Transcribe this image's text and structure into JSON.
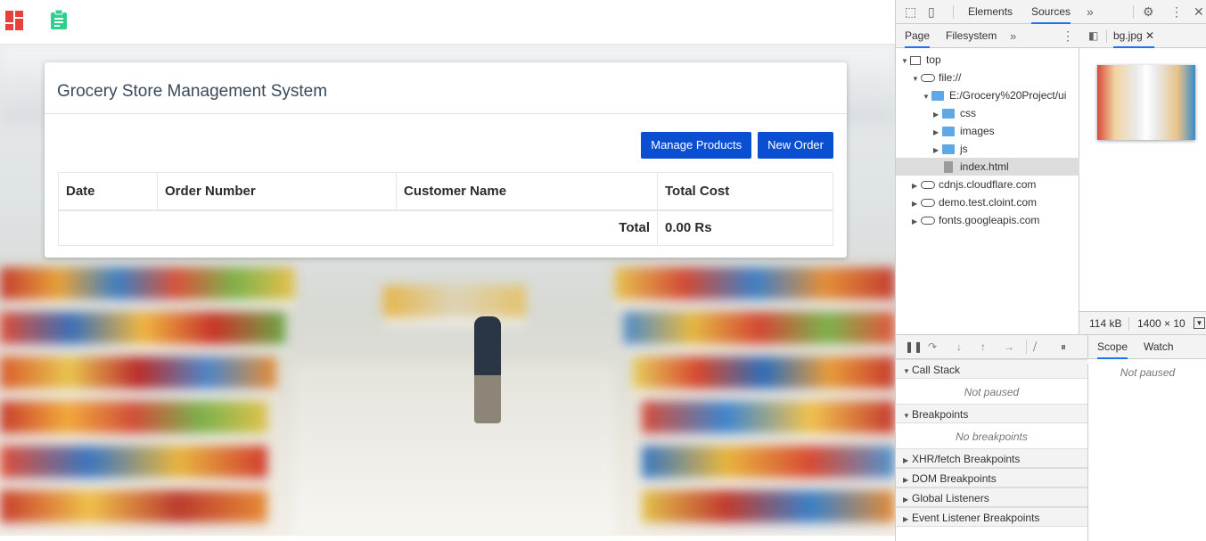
{
  "page": {
    "title": "Grocery Store Management System",
    "buttons": {
      "manage_products": "Manage Products",
      "new_order": "New Order"
    },
    "table": {
      "headers": [
        "Date",
        "Order Number",
        "Customer Name",
        "Total Cost"
      ],
      "total_label": "Total",
      "total_value": "0.00 Rs"
    }
  },
  "devtools": {
    "tabs": [
      "Elements",
      "Sources"
    ],
    "active_tab": "Sources",
    "more": "»",
    "navigator_tabs": [
      "Page",
      "Filesystem"
    ],
    "tree": {
      "top": "top",
      "file": "file://",
      "project": "E:/Grocery%20Project/ui",
      "folders": [
        "css",
        "images",
        "js"
      ],
      "selected_file": "index.html",
      "domains": [
        "cdnjs.cloudflare.com",
        "demo.test.cloint.com",
        "fonts.googleapis.com"
      ]
    },
    "open_file": "bg.jpg",
    "image_size": "114 kB",
    "image_dims": "1400 × 10",
    "debugger": {
      "scope_tabs": [
        "Scope",
        "Watch"
      ],
      "not_paused": "Not paused",
      "sections": {
        "call_stack": "Call Stack",
        "call_stack_empty": "Not paused",
        "breakpoints": "Breakpoints",
        "breakpoints_empty": "No breakpoints",
        "xhr": "XHR/fetch Breakpoints",
        "dom": "DOM Breakpoints",
        "global": "Global Listeners",
        "event": "Event Listener Breakpoints"
      }
    }
  },
  "colors": {
    "primary_button": "#0a4fd1",
    "logo_red": "#e8413c",
    "clipboard_green": "#2fcf8f"
  }
}
